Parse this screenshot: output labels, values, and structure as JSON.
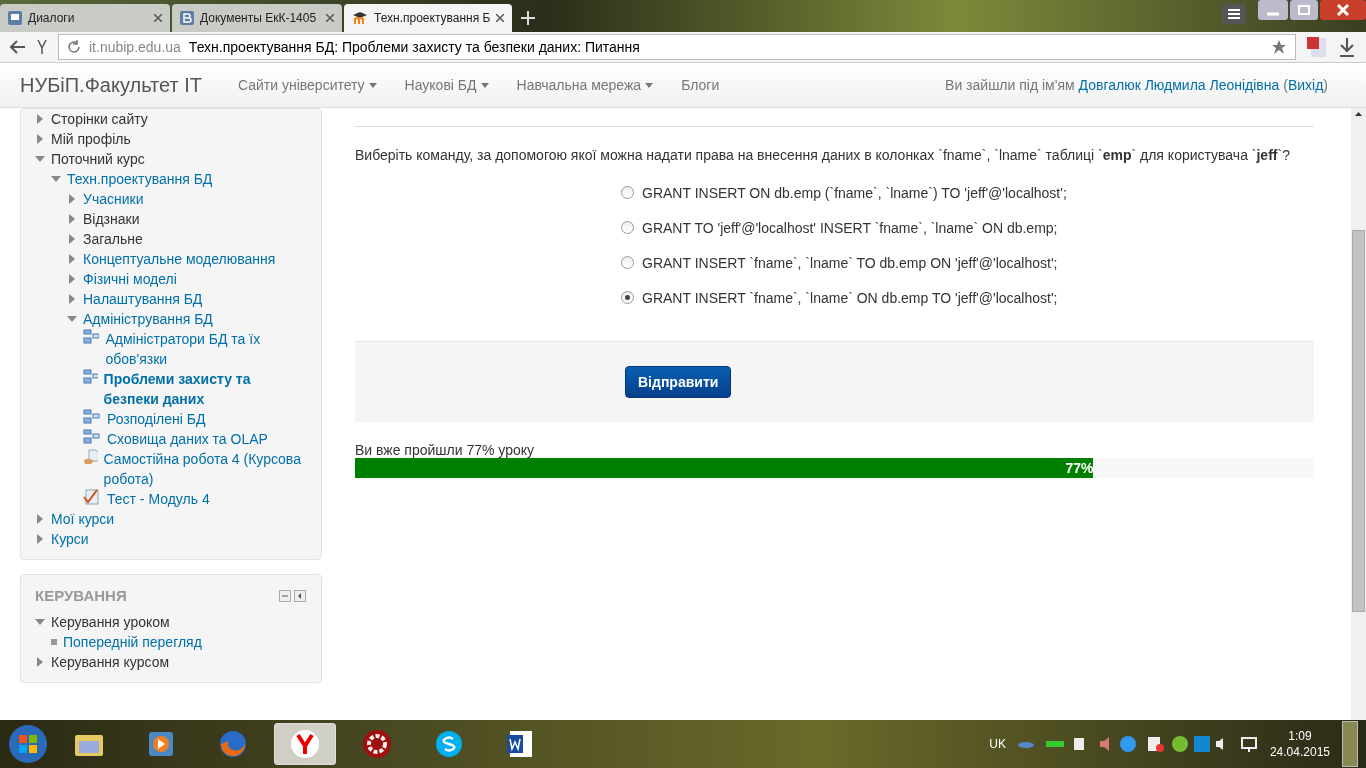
{
  "browser": {
    "tabs": [
      {
        "title": "Диалоги",
        "selected": false,
        "kind": "chat"
      },
      {
        "title": "Документы ЕкК-1405",
        "selected": false,
        "kind": "vk"
      },
      {
        "title": "Техн.проектування Б",
        "selected": true,
        "kind": "moodle"
      }
    ],
    "url_host": "it.nubip.edu.ua",
    "page_title": "Техн.проектування БД: Проблеми захисту та безпеки даних: Питання"
  },
  "navbar": {
    "brand": "НУБіП.Факультет ІТ",
    "menus": [
      "Сайти університету",
      "Наукові БД",
      "Навчальна мережа"
    ],
    "links": [
      "Блоги"
    ],
    "login_prefix": "Ви зайшли під ім'ям",
    "user": "Довгалюк Людмила Леонідівна",
    "paren_open": "(",
    "logout": "Вихід",
    "paren_close": ")"
  },
  "navigation": [
    {
      "label": "Сторінки сайту",
      "link": false,
      "expanded": false
    },
    {
      "label": "Мій профіль",
      "link": false,
      "expanded": false
    },
    {
      "label": "Поточний курс",
      "link": false,
      "expanded": true,
      "children": [
        {
          "label": "Техн.проектування БД",
          "link": true,
          "expanded": true,
          "children": [
            {
              "label": "Учасники",
              "link": true,
              "expanded": false
            },
            {
              "label": "Відзнаки",
              "link": false,
              "expanded": false
            },
            {
              "label": "Загальне",
              "link": false,
              "expanded": false
            },
            {
              "label": "Концептуальне моделювання",
              "link": true,
              "expanded": false
            },
            {
              "label": "Фізичні моделі",
              "link": true,
              "expanded": false
            },
            {
              "label": "Налаштування БД",
              "link": true,
              "expanded": false
            },
            {
              "label": "Адміністрування БД",
              "link": true,
              "expanded": true,
              "children": [
                {
                  "label": "Адміністратори БД та їх обов'язки",
                  "kind": "lesson",
                  "selected": false
                },
                {
                  "label": "Проблеми захисту та безпеки даних",
                  "kind": "lesson",
                  "selected": true
                },
                {
                  "label": "Розподілені БД",
                  "kind": "lesson",
                  "selected": false
                },
                {
                  "label": "Сховища даних та OLAP",
                  "kind": "lesson",
                  "selected": false
                },
                {
                  "label": "Самостійна робота 4 (Курсова робота)",
                  "kind": "assignment",
                  "selected": false
                },
                {
                  "label": "Тест - Модуль 4",
                  "kind": "quiz",
                  "selected": false
                }
              ]
            }
          ]
        }
      ]
    },
    {
      "label": "Мої курси",
      "link": true,
      "expanded": false
    },
    {
      "label": "Курси",
      "link": true,
      "expanded": false
    }
  ],
  "admin_block": {
    "title": "КЕРУВАННЯ",
    "items": [
      {
        "label": "Керування уроком",
        "expanded": true,
        "children": [
          {
            "label": "Попередній перегляд"
          }
        ]
      },
      {
        "label": "Керування курсом",
        "expanded": false
      }
    ]
  },
  "question": {
    "text": "Виберіть команду, за допомогою якої можна надати права на внесення даних в колонках `fname`, `lname` таблиці `**emp**` для користувача `**jeff**`?",
    "options": [
      {
        "label": "GRANT INSERT ON db.emp (`fname`, `lname`) TO 'jeff'@'localhost';",
        "selected": false
      },
      {
        "label": "GRANT TO 'jeff'@'localhost' INSERT `fname`, `lname` ON db.emp;",
        "selected": false
      },
      {
        "label": "GRANT INSERT `fname`, `lname` TO db.emp ON 'jeff'@'localhost';",
        "selected": false
      },
      {
        "label": "GRANT INSERT `fname`, `lname` ON db.emp TO 'jeff'@'localhost';",
        "selected": true
      }
    ],
    "submit": "Відправити"
  },
  "progress": {
    "label": "Ви вже пройшли 77% уроку",
    "reading": "77%",
    "level": 0.77
  },
  "taskbar": {
    "apps": [
      {
        "kind": "folder",
        "active": false
      },
      {
        "kind": "player",
        "active": false
      },
      {
        "kind": "firefox",
        "active": false
      },
      {
        "kind": "yandex",
        "active": true
      },
      {
        "kind": "gear",
        "active": false
      },
      {
        "kind": "skype",
        "active": false
      },
      {
        "kind": "word",
        "active": false
      }
    ],
    "language": "UK",
    "time": "1:09",
    "date": "24.04.2015"
  }
}
